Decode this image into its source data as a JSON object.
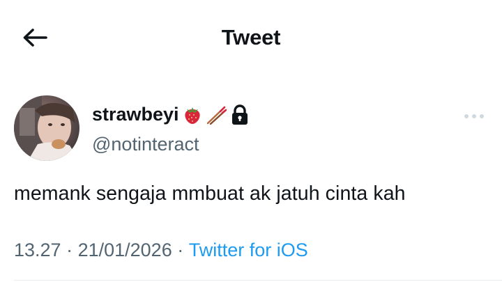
{
  "header": {
    "title": "Tweet",
    "back_icon": "arrow-left-icon"
  },
  "author": {
    "display_name": "strawbeyi",
    "badges": [
      "strawberry-icon",
      "chopsticks-icon",
      "lock-icon"
    ],
    "handle": "@notinteract"
  },
  "tweet": {
    "text": "memank sengaja mmbuat ak jatuh cinta kah",
    "time": "13.27",
    "separator": " · ",
    "date": "21/01/2026",
    "source": "Twitter for iOS"
  },
  "colors": {
    "text": "#0f1419",
    "secondary": "#536471",
    "link": "#1d9bf0",
    "divider": "#e6ecf0"
  }
}
